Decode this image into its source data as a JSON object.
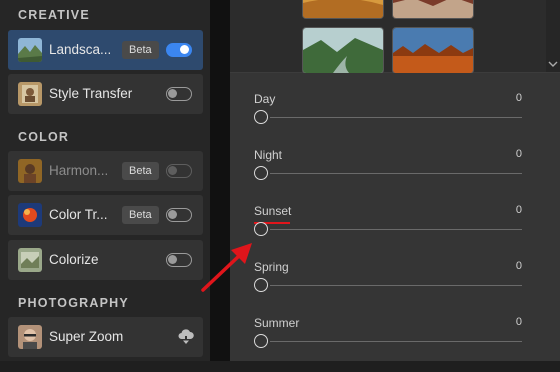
{
  "left_panel": {
    "creative_title": "CREATIVE",
    "color_title": "COLOR",
    "photography_title": "PHOTOGRAPHY",
    "creative_items": [
      {
        "label": "Landsca...",
        "badge": "Beta",
        "toggle": "on",
        "active": true
      },
      {
        "label": "Style Transfer",
        "toggle": "off"
      }
    ],
    "color_items": [
      {
        "label": "Harmon...",
        "badge": "Beta",
        "toggle": "off",
        "disabled": true
      },
      {
        "label": "Color Tr...",
        "badge": "Beta",
        "toggle": "off"
      },
      {
        "label": "Colorize",
        "toggle": "off"
      }
    ],
    "photography_items": [
      {
        "label": "Super Zoom",
        "icon": "cloud-download-icon"
      }
    ]
  },
  "sliders": [
    {
      "name": "Day",
      "value": "0"
    },
    {
      "name": "Night",
      "value": "0"
    },
    {
      "name": "Sunset",
      "value": "0",
      "highlighted": true
    },
    {
      "name": "Spring",
      "value": "0"
    },
    {
      "name": "Summer",
      "value": "0"
    }
  ],
  "colors": {
    "accent": "#3b86f0",
    "active_item": "#2e4a6e",
    "annotation": "#e0151b"
  }
}
